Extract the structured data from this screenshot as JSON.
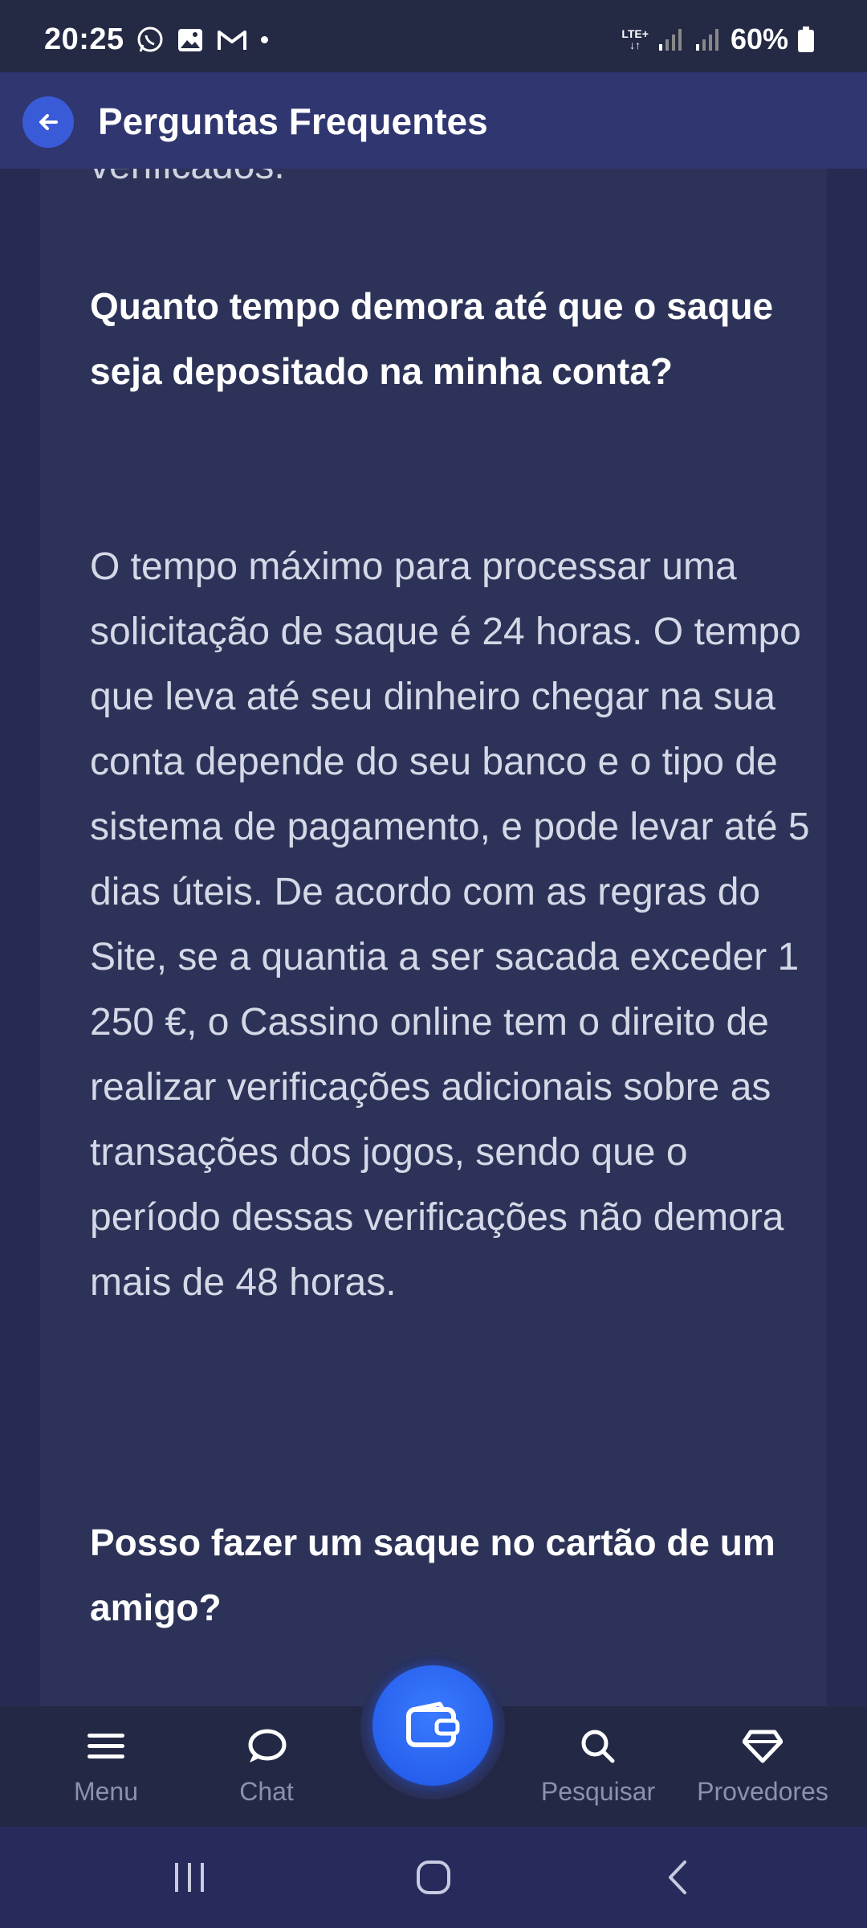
{
  "status_bar": {
    "time": "20:25",
    "network": "LTE+",
    "battery": "60%"
  },
  "header": {
    "title": "Perguntas Frequentes"
  },
  "content": {
    "cut_text": "verificados.",
    "q1": "Quanto tempo demora até que o saque seja depositado na minha conta?",
    "a1": "O tempo máximo para processar uma solicitação de saque é 24 horas. O tempo que leva até seu dinheiro chegar na sua conta depende do seu banco e o tipo de sistema de pagamento, e pode levar até 5 dias úteis. De acordo com as regras do Site, se a quantia a ser sacada exceder 1 250 €, o Cassino online tem o direito de realizar verificações adicionais sobre as transações dos jogos, sendo que o período dessas verificações não demora mais de 48 horas.",
    "q2": "Posso fazer um saque no cartão de um amigo?"
  },
  "bottom_nav": {
    "menu": "Menu",
    "chat": "Chat",
    "search": "Pesquisar",
    "providers": "Provedores"
  },
  "colors": {
    "accent": "#3a5bd8",
    "fab": "#2e6bff",
    "panel": "#2d3358"
  }
}
